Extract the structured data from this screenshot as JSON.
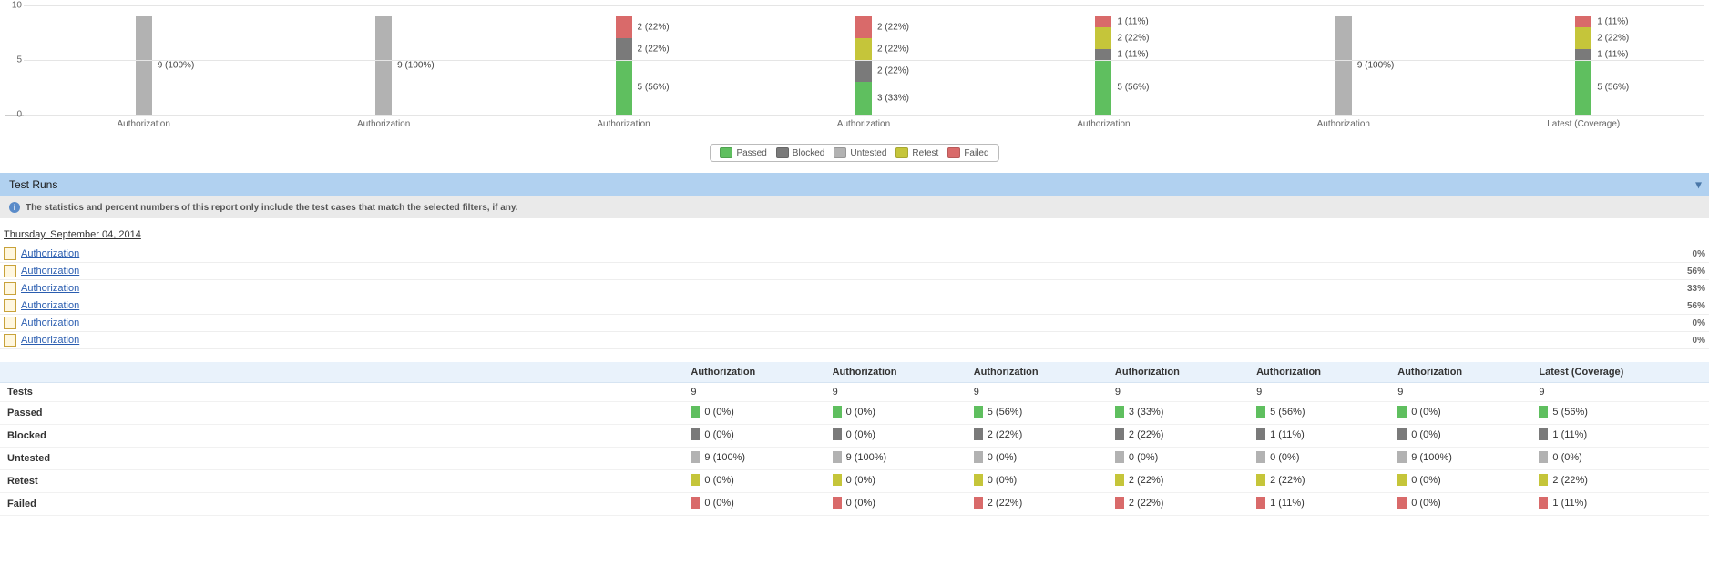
{
  "chart_data": {
    "type": "bar",
    "stacked": true,
    "ylabel": "",
    "xlabel": "",
    "ylim": [
      0,
      10
    ],
    "yticks": [
      0,
      5,
      10
    ],
    "categories": [
      "Authorization",
      "Authorization",
      "Authorization",
      "Authorization",
      "Authorization",
      "Authorization",
      "Latest (Coverage)"
    ],
    "series_order": [
      "passed",
      "blocked",
      "untested",
      "retest",
      "failed"
    ],
    "colors": {
      "passed": "#5fbf5f",
      "blocked": "#7a7a7a",
      "untested": "#b2b2b2",
      "retest": "#c5c53a",
      "failed": "#d96a6a"
    },
    "columns": [
      {
        "segments": [
          {
            "status": "untested",
            "value": 9,
            "label": "9 (100%)"
          }
        ]
      },
      {
        "segments": [
          {
            "status": "untested",
            "value": 9,
            "label": "9 (100%)"
          }
        ]
      },
      {
        "segments": [
          {
            "status": "passed",
            "value": 5,
            "label": "5 (56%)"
          },
          {
            "status": "blocked",
            "value": 2,
            "label": "2 (22%)"
          },
          {
            "status": "failed",
            "value": 2,
            "label": "2 (22%)"
          }
        ]
      },
      {
        "segments": [
          {
            "status": "passed",
            "value": 3,
            "label": "3 (33%)"
          },
          {
            "status": "blocked",
            "value": 2,
            "label": "2 (22%)"
          },
          {
            "status": "retest",
            "value": 2,
            "label": "2 (22%)"
          },
          {
            "status": "failed",
            "value": 2,
            "label": "2 (22%)"
          }
        ]
      },
      {
        "segments": [
          {
            "status": "passed",
            "value": 5,
            "label": "5 (56%)"
          },
          {
            "status": "blocked",
            "value": 1,
            "label": "1 (11%)"
          },
          {
            "status": "retest",
            "value": 2,
            "label": "2 (22%)"
          },
          {
            "status": "failed",
            "value": 1,
            "label": "1 (11%)"
          }
        ]
      },
      {
        "segments": [
          {
            "status": "untested",
            "value": 9,
            "label": "9 (100%)"
          }
        ]
      },
      {
        "segments": [
          {
            "status": "passed",
            "value": 5,
            "label": "5 (56%)"
          },
          {
            "status": "blocked",
            "value": 1,
            "label": "1 (11%)"
          },
          {
            "status": "retest",
            "value": 2,
            "label": "2 (22%)"
          },
          {
            "status": "failed",
            "value": 1,
            "label": "1 (11%)"
          }
        ]
      }
    ]
  },
  "legend": {
    "items": [
      {
        "key": "passed",
        "label": "Passed"
      },
      {
        "key": "blocked",
        "label": "Blocked"
      },
      {
        "key": "untested",
        "label": "Untested"
      },
      {
        "key": "retest",
        "label": "Retest"
      },
      {
        "key": "failed",
        "label": "Failed"
      }
    ]
  },
  "section": {
    "title": "Test Runs"
  },
  "info_text": "The statistics and percent numbers of this report only include the test cases that match the selected filters, if any.",
  "date_heading": "Thursday, September 04, 2014",
  "runs": [
    {
      "label": "Authorization",
      "pct": "0%"
    },
    {
      "label": "Authorization",
      "pct": "56%"
    },
    {
      "label": "Authorization",
      "pct": "33%"
    },
    {
      "label": "Authorization",
      "pct": "56%"
    },
    {
      "label": "Authorization",
      "pct": "0%"
    },
    {
      "label": "Authorization",
      "pct": "0%"
    }
  ],
  "stats": {
    "columns": [
      "Authorization",
      "Authorization",
      "Authorization",
      "Authorization",
      "Authorization",
      "Authorization",
      "Latest (Coverage)"
    ],
    "rows": [
      {
        "label": "Tests",
        "status": null,
        "cells": [
          "9",
          "9",
          "9",
          "9",
          "9",
          "9",
          "9"
        ]
      },
      {
        "label": "Passed",
        "status": "passed",
        "cells": [
          "0 (0%)",
          "0 (0%)",
          "5 (56%)",
          "3 (33%)",
          "5 (56%)",
          "0 (0%)",
          "5 (56%)"
        ]
      },
      {
        "label": "Blocked",
        "status": "blocked",
        "cells": [
          "0 (0%)",
          "0 (0%)",
          "2 (22%)",
          "2 (22%)",
          "1 (11%)",
          "0 (0%)",
          "1 (11%)"
        ]
      },
      {
        "label": "Untested",
        "status": "untested",
        "cells": [
          "9 (100%)",
          "9 (100%)",
          "0 (0%)",
          "0 (0%)",
          "0 (0%)",
          "9 (100%)",
          "0 (0%)"
        ]
      },
      {
        "label": "Retest",
        "status": "retest",
        "cells": [
          "0 (0%)",
          "0 (0%)",
          "0 (0%)",
          "2 (22%)",
          "2 (22%)",
          "0 (0%)",
          "2 (22%)"
        ]
      },
      {
        "label": "Failed",
        "status": "failed",
        "cells": [
          "0 (0%)",
          "0 (0%)",
          "2 (22%)",
          "2 (22%)",
          "1 (11%)",
          "0 (0%)",
          "1 (11%)"
        ]
      }
    ]
  }
}
